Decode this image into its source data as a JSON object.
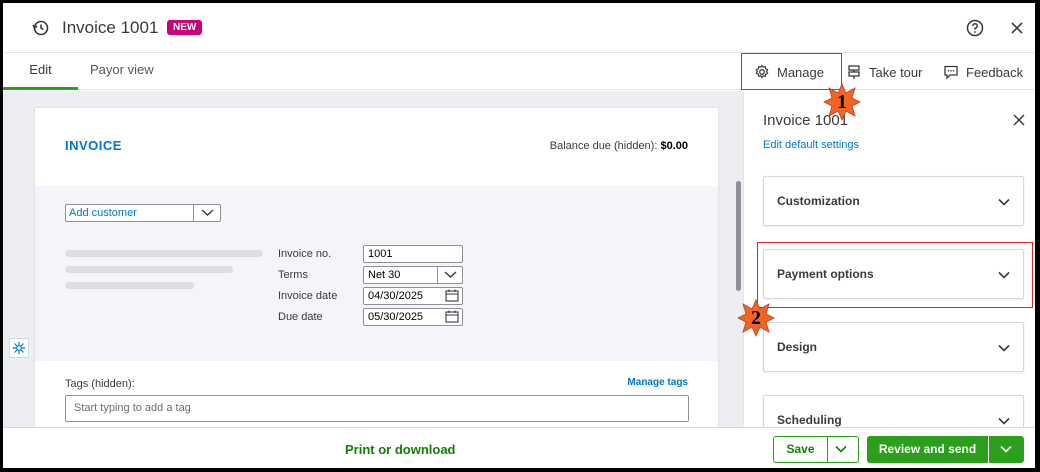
{
  "header": {
    "title": "Invoice 1001",
    "badge": "NEW"
  },
  "tabs": [
    {
      "label": "Edit",
      "active": true
    },
    {
      "label": "Payor view",
      "active": false
    }
  ],
  "toolbar": {
    "manage": "Manage",
    "take_tour": "Take tour",
    "feedback": "Feedback"
  },
  "invoice": {
    "heading": "INVOICE",
    "balance_label": "Balance due (hidden):",
    "balance_value": "$0.00",
    "customer_placeholder": "Add customer",
    "fields": {
      "invoice_no_label": "Invoice no.",
      "invoice_no": "1001",
      "terms_label": "Terms",
      "terms": "Net 30",
      "invoice_date_label": "Invoice date",
      "invoice_date": "04/30/2025",
      "due_date_label": "Due date",
      "due_date": "05/30/2025"
    },
    "tags_label": "Tags (hidden):",
    "manage_tags": "Manage tags",
    "tags_placeholder": "Start typing to add a tag"
  },
  "panel": {
    "title": "Invoice 1001",
    "edit_defaults": "Edit default settings",
    "sections": [
      "Customization",
      "Payment options",
      "Design",
      "Scheduling"
    ]
  },
  "footer": {
    "print": "Print or download",
    "save": "Save",
    "review_send": "Review and send"
  },
  "markers": [
    "1",
    "2"
  ],
  "colors": {
    "accent_green": "#2ca01c",
    "link_blue": "#0077c5",
    "badge_magenta": "#c9007a",
    "highlight_red": "#d52b1e",
    "marker_orange": "#f26522"
  }
}
